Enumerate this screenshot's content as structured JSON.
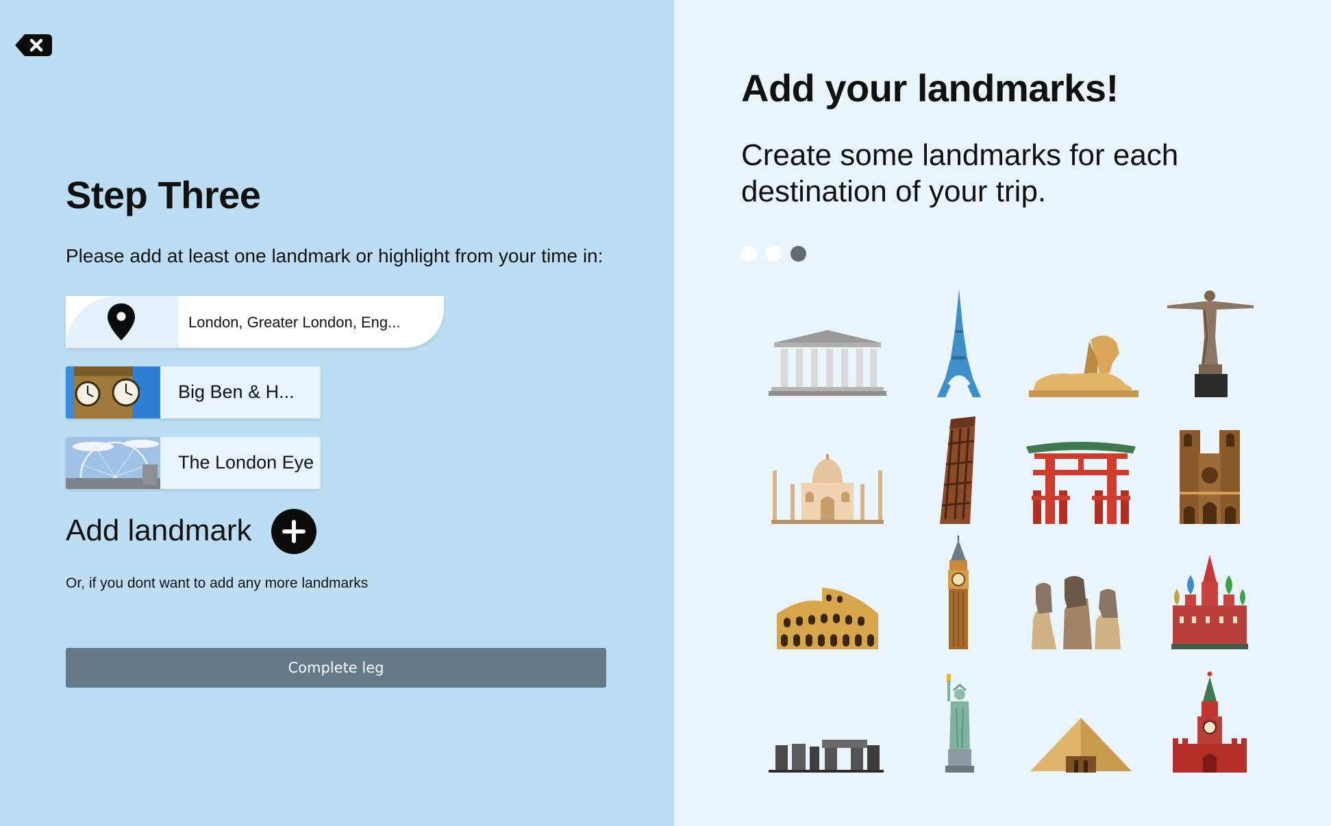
{
  "close_button": {
    "icon": "backspace-x-icon"
  },
  "step": {
    "title": "Step Three",
    "instruction": "Please add at least one landmark or highlight from your time in:",
    "location": "London, Greater London, Eng...",
    "location_icon": "map-pin-icon"
  },
  "landmarks": [
    {
      "name": "Big Ben & H...",
      "thumbnail": "big-ben-thumbnail"
    },
    {
      "name": "The London Eye",
      "thumbnail": "london-eye-thumbnail"
    }
  ],
  "add_landmark": {
    "label": "Add landmark",
    "icon": "plus-circle-icon"
  },
  "or_text": "Or, if you dont want to add any more landmarks",
  "complete_button": "Complete leg",
  "info": {
    "title": "Add your landmarks!",
    "subtitle": "Create some landmarks for each destination of your trip.",
    "carousel": {
      "total": 3,
      "active": 3
    }
  },
  "illustrations": [
    "parthenon-icon",
    "eiffel-tower-icon",
    "sphinx-icon",
    "christ-the-redeemer-icon",
    "taj-mahal-icon",
    "leaning-tower-of-pisa-icon",
    "torii-gate-icon",
    "notre-dame-icon",
    "colosseum-icon",
    "big-ben-icon",
    "moai-icon",
    "st-basils-cathedral-icon",
    "stonehenge-icon",
    "statue-of-liberty-icon",
    "pyramid-icon",
    "kremlin-tower-icon"
  ],
  "colors": {
    "left_panel": "#bddef2",
    "right_panel": "#e9f4fb",
    "button": "#64798a",
    "dot_active": "#666b70"
  }
}
